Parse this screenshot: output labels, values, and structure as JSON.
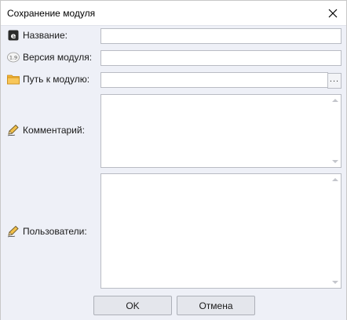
{
  "window": {
    "title": "Сохранение модуля",
    "close_icon": "close-icon"
  },
  "form": {
    "name_label": "Название:",
    "version_label": "Версия модуля:",
    "path_label": "Путь к модулю:",
    "comment_label": "Комментарий:",
    "users_label": "Пользователи:",
    "name_value": "",
    "version_value": "",
    "path_value": "",
    "browse_label": "...",
    "comment_value": "",
    "users_value": ""
  },
  "icons": {
    "name": "name-badge-icon",
    "version": "version-badge-icon",
    "path": "folder-icon",
    "comment": "edit-pencil-icon",
    "users": "edit-pencil-icon"
  },
  "buttons": {
    "ok_label": "OK",
    "cancel_label": "Отмена"
  },
  "colors": {
    "background": "#eef0f7",
    "folder": "#f2b234",
    "field_border": "#b9bcc4"
  }
}
